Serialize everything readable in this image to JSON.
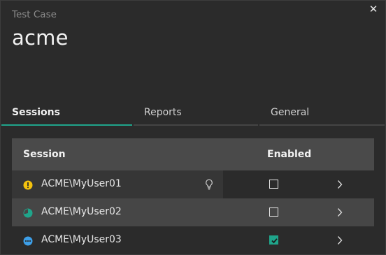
{
  "window": {
    "close_glyph": "✕"
  },
  "header": {
    "subtitle": "Test Case",
    "title": "acme"
  },
  "tabs": [
    {
      "label": "Sessions",
      "active": true
    },
    {
      "label": "Reports",
      "active": false
    },
    {
      "label": "General",
      "active": false
    }
  ],
  "table": {
    "columns": {
      "session": "Session",
      "enabled": "Enabled"
    },
    "rows": [
      {
        "user": "ACME\\MyUser01",
        "status_icon": "warning-icon",
        "status_color": "#f4c20d",
        "has_hint": true,
        "enabled": false
      },
      {
        "user": "ACME\\MyUser02",
        "status_icon": "progress-icon",
        "status_color": "#1fa58b",
        "has_hint": false,
        "enabled": false
      },
      {
        "user": "ACME\\MyUser03",
        "status_icon": "pending-icon",
        "status_color": "#3d9fe8",
        "has_hint": false,
        "enabled": true
      }
    ]
  },
  "colors": {
    "accent": "#1fa58b",
    "background": "#2b2b2b",
    "header_row": "#4a4a4a"
  }
}
